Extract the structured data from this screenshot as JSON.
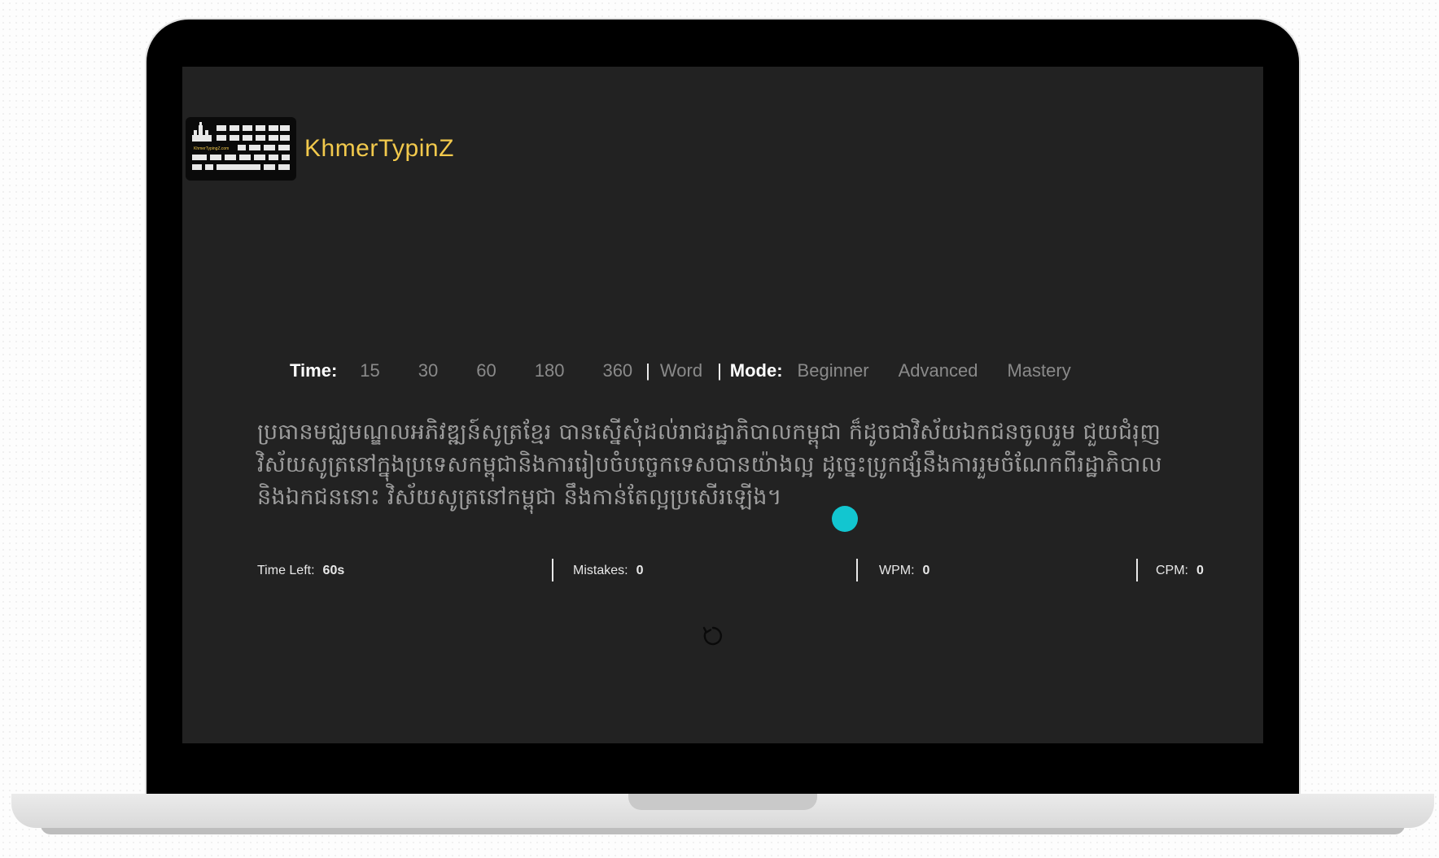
{
  "brand": {
    "name": "KhmerTypinZ",
    "logo_caption": "KhmerTypingZ.com"
  },
  "options": {
    "time_label": "Time:",
    "times": [
      "15",
      "30",
      "60",
      "180",
      "360"
    ],
    "word_label": "Word",
    "mode_label": "Mode:",
    "modes": [
      "Beginner",
      "Advanced",
      "Mastery"
    ]
  },
  "passage": {
    "text": "ប្រធានមជ្ឈមណ្ឌលអភិវឌ្ឍន៍សូត្រខ្មែរ បានស្នើសុំដល់រាជរដ្ឋាភិបាលកម្ពុជា ក៏ដូចជាវិស័យឯកជនចូលរួម ជួយជំរុញវិស័យសូត្រនៅក្នុងប្រទេសកម្ពុជានិងការរៀបចំបច្ចេកទេសបានយ៉ាងល្អ ដូច្នេះប្រូកផ្សំនឹងការរួមចំណែកពីរដ្ឋាភិបាលនិងឯកជននោះ វិស័យសូត្រនៅកម្ពុជា នឹងកាន់តែល្អប្រសើរឡើង។"
  },
  "stats": {
    "time_left_label": "Time Left:",
    "time_left_value": "60s",
    "mistakes_label": "Mistakes:",
    "mistakes_value": "0",
    "wpm_label": "WPM:",
    "wpm_value": "0",
    "cpm_label": "CPM:",
    "cpm_value": "0"
  },
  "icons": {
    "restart": "restart-icon",
    "logo": "keyboard-logo-icon"
  },
  "colors": {
    "screen_bg": "#222222",
    "brand": "#f2c94c",
    "muted_text": "#9d9d9d",
    "cursor": "#12c6d0"
  }
}
